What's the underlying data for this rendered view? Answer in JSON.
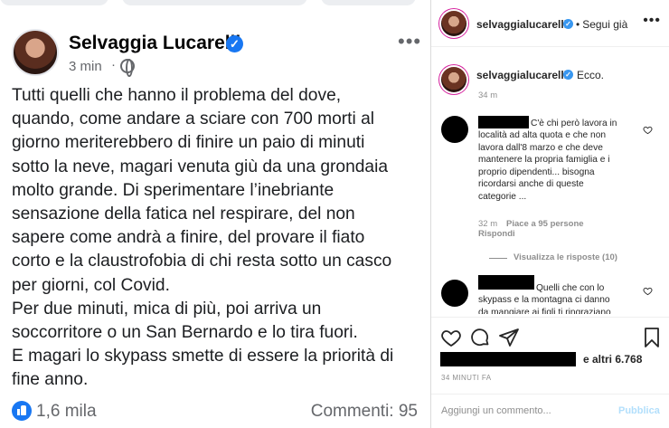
{
  "facebook": {
    "author": "Selvaggia Lucarelli",
    "time": "3 min",
    "dot": "·",
    "more_label": "•••",
    "post_lines": [
      "Tutti quelli che hanno il problema del dove,",
      "quando, come andare a sciare con 700 morti al",
      "giorno meriterebbero di finire un paio di minuti",
      "sotto la neve, magari venuta giù da una grondaia",
      "molto grande. Di sperimentare l’inebriante",
      "sensazione della fatica nel respirare, del non",
      "sapere come andrà a finire, del provare il fiato",
      "corto e la claustrofobia di chi resta sotto un casco",
      "per giorni, col Covid.",
      "Per due minuti, mica di più, poi arriva un",
      "soccorritore o un San Bernardo e lo tira fuori.",
      "E magari lo skypass smette di essere la priorità di",
      "fine anno."
    ],
    "reactions": "1,6 mila",
    "comments": "Commenti: 95",
    "colors": {
      "accent": "#1877f2",
      "secondary_text": "#65676b"
    }
  },
  "instagram": {
    "handle": "selvaggialucarelli",
    "follow_label": "Segui già",
    "separator": "•",
    "more_label": "•••",
    "caption": {
      "handle": "selvaggialucarelli",
      "text": "Ecco.",
      "time": "34 m"
    },
    "comment1": {
      "lines": [
        "C'è chi però lavora in",
        "località ad alta quota e che non",
        "lavora dall'8 marzo e che deve",
        "mantenere la propria famiglia e i",
        "proprio dipendenti... bisogna",
        "ricordarsi anche di queste",
        "categorie ..."
      ],
      "time": "32 m",
      "likes": "Piace a 95 persone",
      "reply": "Rispondi",
      "view_replies": "Visualizza le risposte (10)"
    },
    "comment2": {
      "lines": [
        "Quelli che con lo",
        "skypass e la montagna ci danno",
        "da mangiare ai figli ti ringraziano"
      ]
    },
    "likes_suffix": "e altri 6.768",
    "date": "34 MINUTI FA",
    "comment_placeholder": "Aggiungi un commento...",
    "publish_label": "Pubblica",
    "colors": {
      "link": "#3897f0",
      "publish_disabled": "#b2dffc",
      "muted": "#8e8e8e"
    }
  }
}
